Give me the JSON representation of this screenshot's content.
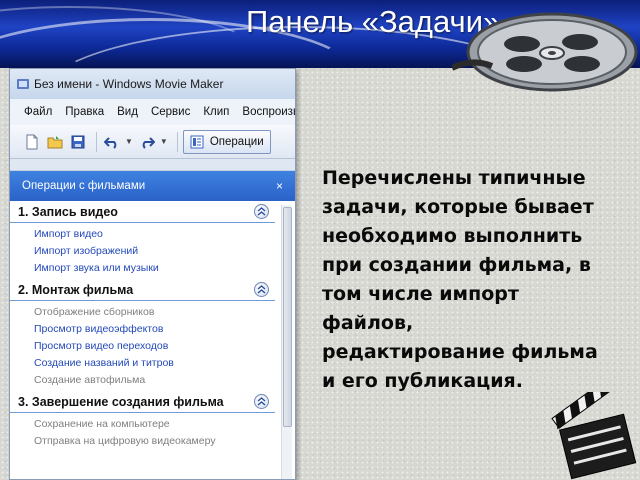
{
  "slide": {
    "title": "Панель «Задачи»",
    "description": "Перечислены типичные задачи, которые бывает необходимо выполнить при создании фильма, в том числе импорт файлов, редактирование фильма и его публикация."
  },
  "window": {
    "title": "Без имени - Windows Movie Maker",
    "menu": [
      "Файл",
      "Правка",
      "Вид",
      "Сервис",
      "Клип",
      "Воспроизведение"
    ],
    "toolbar": {
      "icons": [
        "new-file-icon",
        "open-folder-icon",
        "save-icon",
        "undo-icon",
        "redo-icon",
        "operations-icon"
      ],
      "operations_label": "Операции"
    }
  },
  "tasks_panel": {
    "header": "Операции с фильмами",
    "close_glyph": "×",
    "sections": [
      {
        "title": "1. Запись видео",
        "tasks": [
          {
            "label": "Импорт видео",
            "enabled": true
          },
          {
            "label": "Импорт изображений",
            "enabled": true
          },
          {
            "label": "Импорт звука или музыки",
            "enabled": true
          }
        ]
      },
      {
        "title": "2. Монтаж фильма",
        "tasks": [
          {
            "label": "Отображение сборников",
            "enabled": false
          },
          {
            "label": "Просмотр видеоэффектов",
            "enabled": true
          },
          {
            "label": "Просмотр видео переходов",
            "enabled": true
          },
          {
            "label": "Создание названий и титров",
            "enabled": true
          },
          {
            "label": "Создание автофильма",
            "enabled": false
          }
        ]
      },
      {
        "title": "3. Завершение создания фильма",
        "tasks": [
          {
            "label": "Сохранение на компьютере",
            "enabled": false
          },
          {
            "label": "Отправка на цифровую видеокамеру",
            "enabled": false
          }
        ]
      }
    ]
  },
  "colors": {
    "header_band": "#1f43c4",
    "panel_header": "#2a62c8",
    "task_link": "#2349b8",
    "task_disabled": "#7f7f7f",
    "title_text": "#ffffff"
  }
}
